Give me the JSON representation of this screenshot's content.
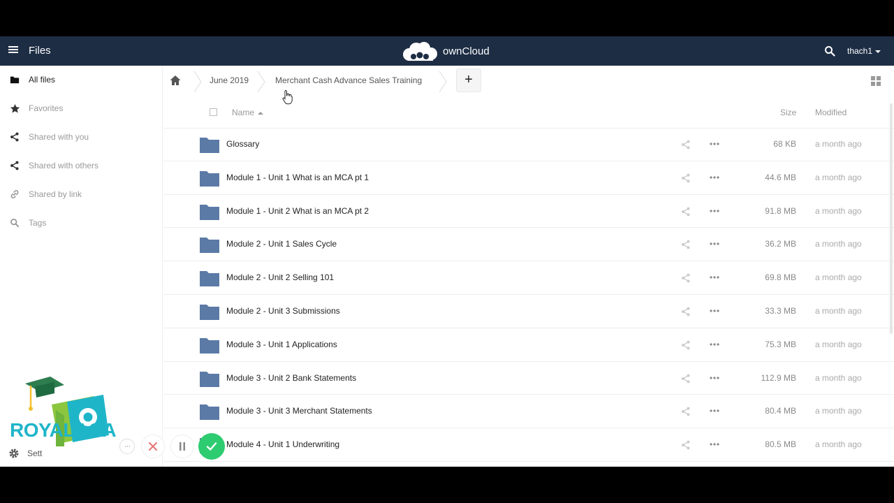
{
  "header": {
    "app_title": "Files",
    "brand_name": "ownCloud",
    "user_name": "thach1",
    "icons": {
      "menu": "hamburger-icon",
      "logo": "cloud-logo",
      "search": "search-icon"
    }
  },
  "sidebar": {
    "items": [
      {
        "label": "All files",
        "icon": "folder-icon",
        "active": true
      },
      {
        "label": "Favorites",
        "icon": "star-icon",
        "active": false
      },
      {
        "label": "Shared with you",
        "icon": "share-icon",
        "active": false
      },
      {
        "label": "Shared with others",
        "icon": "share-icon",
        "active": false
      },
      {
        "label": "Shared by link",
        "icon": "link-icon",
        "active": false
      },
      {
        "label": "Tags",
        "icon": "tag-search-icon",
        "active": false
      }
    ],
    "settings_label": "Sett",
    "logo_text": "ROYALACA"
  },
  "breadcrumb": {
    "home_icon": "home-icon",
    "items": [
      "June 2019",
      "Merchant Cash Advance Sales Training"
    ],
    "new_button": "+"
  },
  "table": {
    "headers": {
      "name": "Name",
      "size": "Size",
      "modified": "Modified"
    },
    "rows": [
      {
        "name": "Glossary",
        "size": "68 KB",
        "modified": "a month ago"
      },
      {
        "name": "Module 1 - Unit 1 What is an MCA pt 1",
        "size": "44.6 MB",
        "modified": "a month ago"
      },
      {
        "name": "Module 1 - Unit 2 What is an MCA pt 2",
        "size": "91.8 MB",
        "modified": "a month ago"
      },
      {
        "name": "Module 2 - Unit 1 Sales Cycle",
        "size": "36.2 MB",
        "modified": "a month ago"
      },
      {
        "name": "Module 2 - Unit 2 Selling 101",
        "size": "69.8 MB",
        "modified": "a month ago"
      },
      {
        "name": "Module 2 - Unit 3 Submissions",
        "size": "33.3 MB",
        "modified": "a month ago"
      },
      {
        "name": "Module 3 - Unit 1 Applications",
        "size": "75.3 MB",
        "modified": "a month ago"
      },
      {
        "name": "Module 3 - Unit 2 Bank Statements",
        "size": "112.9 MB",
        "modified": "a month ago"
      },
      {
        "name": "Module 3 - Unit 3 Merchant Statements",
        "size": "80.4 MB",
        "modified": "a month ago"
      },
      {
        "name": "Module 4 - Unit 1 Underwriting",
        "size": "80.5 MB",
        "modified": "a month ago"
      }
    ]
  },
  "controls": {
    "more": "···"
  },
  "colors": {
    "header_bg": "#1d2d44",
    "folder": "#5b7aa6",
    "ok_green": "#2ecc71",
    "close_red": "#e57373"
  }
}
